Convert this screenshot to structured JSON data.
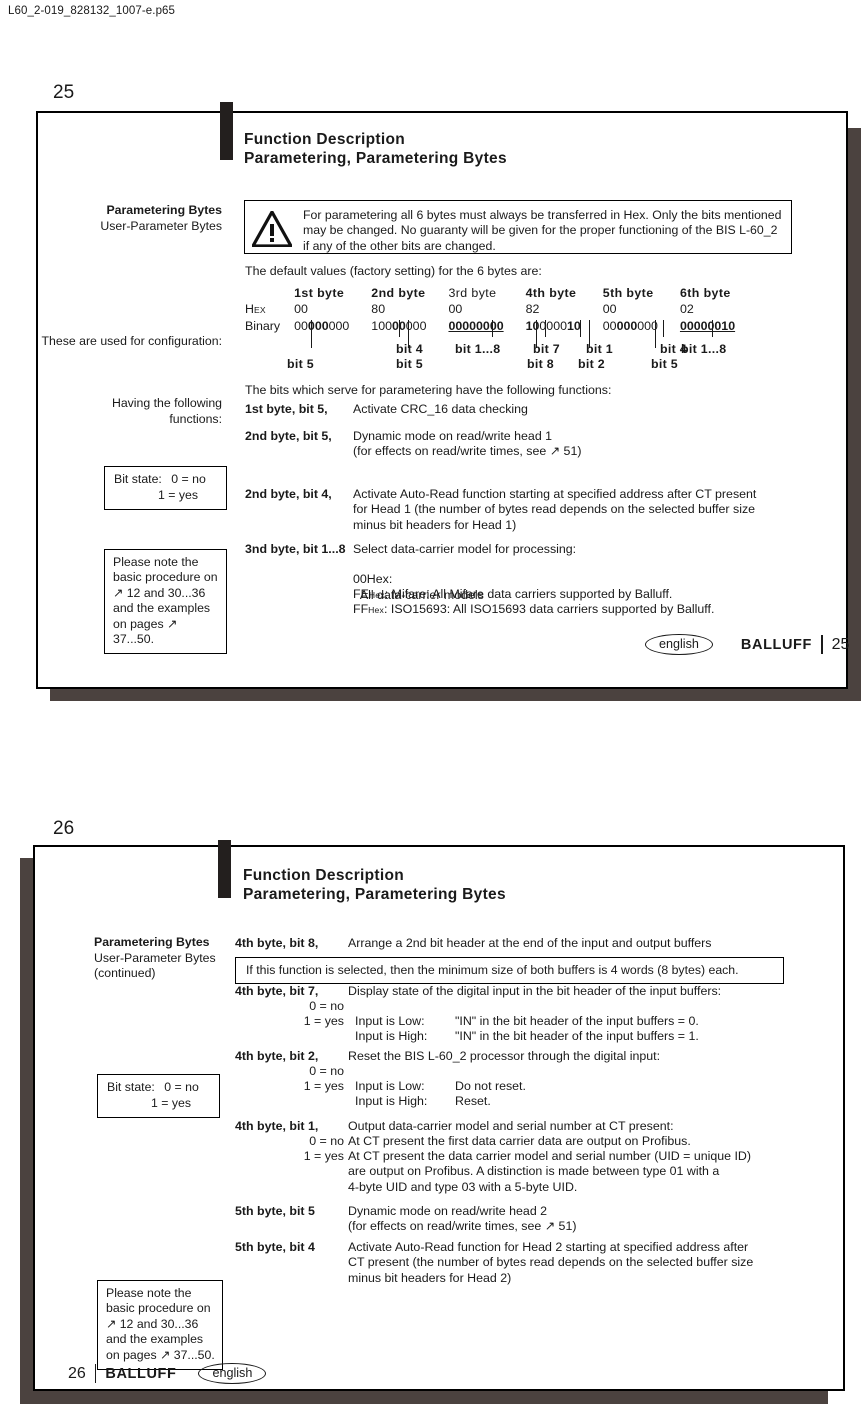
{
  "document": {
    "filename": "L60_2-019_828132_1007-e.p65"
  },
  "page25": {
    "outer_number": "25",
    "header": "Function Description\nParametering, Parametering Bytes",
    "side_label_1": "Parametering Bytes",
    "side_label_1b": "User-Parameter Bytes",
    "warning": "For parametering all 6 bytes must always be transferred in Hex. Only the bits mentioned may be changed. No guaranty will be given for the proper functioning of the BIS L-60_2 if any of the other bits are changed.",
    "intro": "The default values (factory setting) for the 6 bytes are:",
    "table": {
      "row_labels": [
        "",
        "Hex",
        "Binary"
      ],
      "hex_label_main": "H",
      "hex_label_sub": "EX",
      "binary_label": "Binary",
      "columns": [
        {
          "header": "1st byte",
          "header_bold": true,
          "hex": "00",
          "binary": "00000000",
          "binary_bold_from": 2,
          "binary_bold_to": 4,
          "underline": false
        },
        {
          "header": "2nd byte",
          "header_bold": true,
          "hex": "80",
          "binary": "10000000",
          "binary_bold_from": 2,
          "binary_bold_to": 4,
          "underline": false
        },
        {
          "header": "3rd byte",
          "header_bold": false,
          "hex": "00",
          "binary": "00000000",
          "underline": true
        },
        {
          "header": "4th byte",
          "header_bold": true,
          "hex": "82",
          "binary": "10000010",
          "underline": false
        },
        {
          "header": "5th byte",
          "header_bold": true,
          "hex": "00",
          "binary": "00000000",
          "binary_bold_from": 2,
          "binary_bold_to": 4,
          "underline": false
        },
        {
          "header": "6th byte",
          "header_bold": true,
          "hex": "02",
          "binary": "00000010",
          "underline": true
        }
      ],
      "bit_labels": [
        "bit 5",
        "bit 4",
        "bit 5",
        "bit 1...8",
        "bit 7",
        "bit 8",
        "bit 1",
        "bit 2",
        "bit 4",
        "bit 5",
        "bit 1...8"
      ]
    },
    "side_label_2": "These are used for\nconfiguration:",
    "side_label_3": "Having the following\nfunctions:",
    "functions_intro": "The bits which serve for parametering have the following functions:",
    "entries": [
      {
        "key": "1st byte, bit 5,",
        "text": "Activate CRC_16 data checking"
      },
      {
        "key": "2nd byte, bit 5,",
        "text": "Dynamic mode on read/write head 1\n(for effects on read/write times, see ↗ 51)"
      },
      {
        "key": "2nd byte, bit 4,",
        "text": "Activate Auto-Read function starting at specified address after CT present\nfor Head 1 (the number of bytes read depends on the selected buffer size\nminus bit headers for Head 1)"
      },
      {
        "key": "3nd byte, bit 1...8",
        "text": "Select data-carrier model for processing:",
        "sub": [
          {
            "hex": "00Hex:",
            "hexsub": "",
            "text": "All data-carrier models"
          },
          {
            "hex": "FE",
            "hexsub": "Hex",
            "text": ": Mifare: All Mifare data carriers supported by Balluff."
          },
          {
            "hex": "FF",
            "hexsub": "Hex",
            "text": ": ISO15693: All ISO15693 data carriers supported by Balluff."
          }
        ]
      }
    ],
    "bit_state_box": {
      "label": "Bit state:",
      "line1": "0 = no",
      "line2": "1 = yes"
    },
    "note_box": "Please note the\nbasic procedure on\n↗ 12 and 30...36\nand the examples\non pages ↗ 37...50.",
    "footer": {
      "language": "english",
      "brand": "BALLUFF",
      "page": "25"
    }
  },
  "page26": {
    "outer_number": "26",
    "header": "Function Description\nParametering, Parametering Bytes",
    "side_label_1": "Parametering Bytes",
    "side_label_1b": "User-Parameter Bytes",
    "side_label_1c": "(continued)",
    "entries": [
      {
        "key": "4th byte, bit 8,",
        "text": "Arrange a 2nd bit header at the end of the input and output  buffers"
      },
      {
        "key": "4th byte, bit 7,",
        "text": "Display state of the digital input in the bit header of the input buffers:",
        "states": [
          "0 = no",
          "1 = yes"
        ],
        "rows": [
          {
            "label": "Input is Low:",
            "value": "\"IN\" in the bit header of the input buffers = 0."
          },
          {
            "label": "Input is High:",
            "value": "\"IN\" in the bit header of the input buffers = 1."
          }
        ]
      },
      {
        "key": "4th byte, bit 2,",
        "text": "Reset the BIS L-60_2 processor through the digital input:",
        "states": [
          "0 = no",
          "1 = yes"
        ],
        "rows": [
          {
            "label": "Input is Low:",
            "value": "Do not reset."
          },
          {
            "label": "Input is High:",
            "value": "Reset."
          }
        ]
      },
      {
        "key": "4th byte, bit 1,",
        "text": "Output data-carrier model and serial number at CT present:",
        "states": [
          "0 = no",
          "1 = yes"
        ],
        "lines": [
          "At CT present the first data carrier data are output on Profibus.",
          "At CT present the data carrier model and serial number (UID = unique ID)\nare output on Profibus. A distinction is made between type 01 with a\n4-byte UID and type 03 with a 5-byte UID."
        ]
      },
      {
        "key": "5th byte, bit 5",
        "text": "Dynamic mode on read/write head 2\n(for effects on read/write times, see ↗ 51)"
      },
      {
        "key": "5th byte, bit 4",
        "text": "Activate Auto-Read function for Head 2 starting at specified address after\nCT present (the number of bytes read depends on the selected buffer size\nminus bit headers for Head 2)"
      }
    ],
    "info_box": "If this function is selected, then the minimum size of both buffers is 4 words (8 bytes) each.",
    "bit_state_box": {
      "label": "Bit state:",
      "line1": "0 = no",
      "line2": "1 = yes"
    },
    "note_box": "Please note the\nbasic procedure on\n↗ 12 and 30...36\nand the examples\non pages ↗ 37...50.",
    "footer": {
      "page": "26",
      "brand": "BALLUFF",
      "language": "english"
    }
  },
  "colors": {
    "ink": "#1a1a1a",
    "shadow": "#4b423f",
    "paper": "#ffffff"
  }
}
